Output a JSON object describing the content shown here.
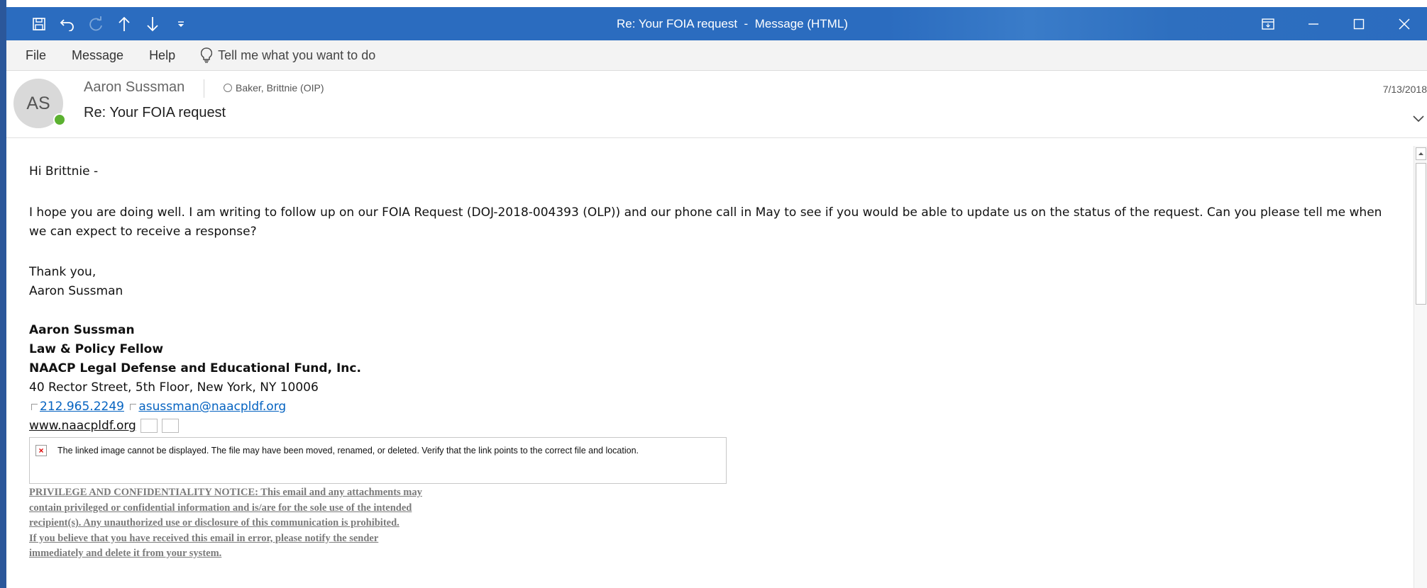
{
  "window": {
    "title": "Re: Your FOIA request  -  Message (HTML)"
  },
  "menu": {
    "file": "File",
    "message": "Message",
    "help": "Help",
    "tell_me": "Tell me what you want to do"
  },
  "header": {
    "avatar_initials": "AS",
    "sender": "Aaron Sussman",
    "recipient": "Baker, Brittnie (OIP)",
    "subject": "Re: Your FOIA request",
    "date": "7/13/2018"
  },
  "body": {
    "greeting": "Hi Brittnie -",
    "paragraph": "I hope you are doing well. I am writing to follow up on our FOIA Request (DOJ-2018-004393 (OLP)) and our phone call in May to see if you would be able to update us on the status of the request. Can you please tell me when we can expect to receive a response?",
    "thanks": "Thank you,",
    "signoff": "Aaron Sussman"
  },
  "signature": {
    "name": "Aaron Sussman",
    "title": "Law & Policy Fellow",
    "org": "NAACP Legal Defense and Educational Fund, Inc.",
    "address": "40 Rector Street, 5th Floor, New York, NY 10006",
    "phone": "212.965.2249",
    "email": "asussman@naacpldf.org",
    "website": "www.naacpldf.org"
  },
  "broken_image": {
    "message": "The linked image cannot be displayed.  The file may have been moved, renamed, or deleted. Verify that the link points to the correct file and location."
  },
  "notice_lines": [
    "PRIVILEGE AND CONFIDENTIALITY NOTICE: This email and any attachments may",
    "contain privileged or confidential information and is/are for the sole use of the intended",
    "recipient(s). Any unauthorized use or disclosure of this communication is prohibited.",
    "If you believe that you have received this email in error, please notify the sender",
    "immediately and delete it from your system."
  ],
  "colors": {
    "titlebar": "#2b6cbf",
    "link": "#0563c1",
    "presence": "#5bb130"
  }
}
